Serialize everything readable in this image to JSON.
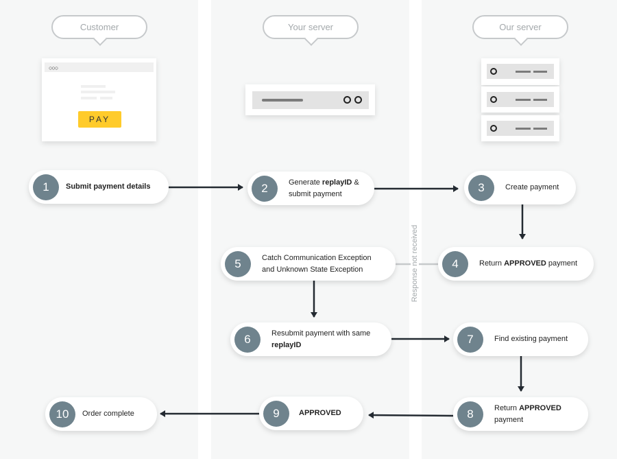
{
  "lanes": {
    "customer": "Customer",
    "your_server": "Your server",
    "our_server": "Our server"
  },
  "pay_button": "PAY",
  "accent_color": "#ffcb2b",
  "steps": [
    {
      "n": "1",
      "pre": "",
      "bold": "Submit payment details",
      "post": ""
    },
    {
      "n": "2",
      "pre": "Generate ",
      "bold": "replayID",
      "post": " & submit payment"
    },
    {
      "n": "3",
      "pre": "Create payment",
      "bold": "",
      "post": ""
    },
    {
      "n": "4",
      "pre": "Return ",
      "bold": "APPROVED",
      "post": " payment"
    },
    {
      "n": "5",
      "pre": "Catch Communication Exception and Unknown State Exception",
      "bold": "",
      "post": ""
    },
    {
      "n": "6",
      "pre": "Resubmit payment with same ",
      "bold": "replayID",
      "post": ""
    },
    {
      "n": "7",
      "pre": "Find existing payment",
      "bold": "",
      "post": ""
    },
    {
      "n": "8",
      "pre": "Return ",
      "bold": "APPROVED",
      "post": " payment"
    },
    {
      "n": "9",
      "pre": "",
      "bold": "APPROVED",
      "post": ""
    },
    {
      "n": "10",
      "pre": "Order complete",
      "bold": "",
      "post": ""
    }
  ],
  "response_label": "Response not received"
}
